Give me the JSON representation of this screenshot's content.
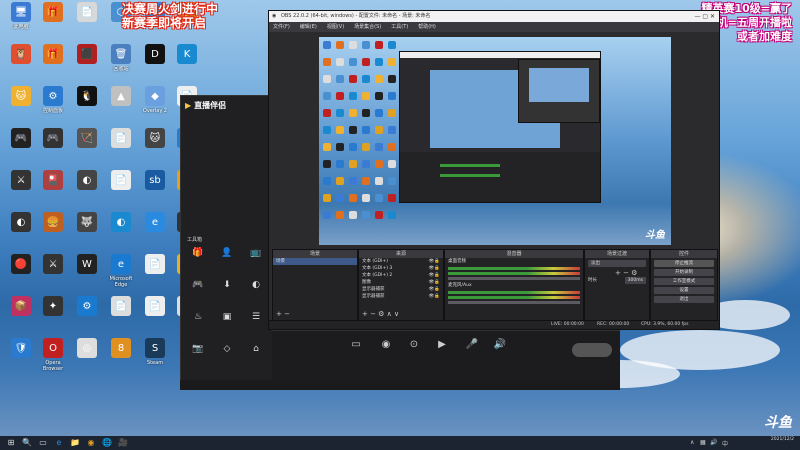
{
  "overlay": {
    "left_line1": "决赛周火剑进行中",
    "left_line2": "新赛季即将开启",
    "right_line1": "精英赛10级=赢了",
    "right_line2": "飞机=五周开播啦",
    "right_line3": "或者加难度"
  },
  "desktop_icons": [
    {
      "label": "此电脑",
      "glyph": "🖥",
      "color": "#3b7bd4"
    },
    {
      "label": "",
      "glyph": "🎁",
      "color": "#e07020"
    },
    {
      "label": "",
      "glyph": "📄",
      "color": "#d8d8d8"
    },
    {
      "label": "",
      "glyph": "⬡",
      "color": "#4a8fd0"
    },
    {
      "label": "网络",
      "glyph": "🌐",
      "color": "#3b7bd4"
    },
    {
      "label": "",
      "glyph": "🎁",
      "color": "#e07020"
    },
    {
      "label": "",
      "glyph": "🦉",
      "color": "#e05030"
    },
    {
      "label": "",
      "glyph": "🎁",
      "color": "#e07020"
    },
    {
      "label": "",
      "glyph": "⬛",
      "color": "#b02020"
    },
    {
      "label": "回收站",
      "glyph": "🗑",
      "color": "#4a7fc0"
    },
    {
      "label": "",
      "glyph": "D",
      "color": "#111"
    },
    {
      "label": "",
      "glyph": "K",
      "color": "#1a8ad0"
    },
    {
      "label": "",
      "glyph": "🐱",
      "color": "#f0b030"
    },
    {
      "label": "控制面板",
      "glyph": "⚙",
      "color": "#2a7ad0"
    },
    {
      "label": "",
      "glyph": "🐧",
      "color": "#111"
    },
    {
      "label": "",
      "glyph": "▲",
      "color": "#c0c0c0"
    },
    {
      "label": "Overlay 2",
      "glyph": "◆",
      "color": "#6aa0e0"
    },
    {
      "label": "",
      "glyph": "📄",
      "color": "#eee"
    },
    {
      "label": "",
      "glyph": "🎮",
      "color": "#222"
    },
    {
      "label": "",
      "glyph": "🎮",
      "color": "#333"
    },
    {
      "label": "",
      "glyph": "🏹",
      "color": "#555"
    },
    {
      "label": "",
      "glyph": "📄",
      "color": "#ddd"
    },
    {
      "label": "",
      "glyph": "🐱",
      "color": "#444"
    },
    {
      "label": "",
      "glyph": "🐦",
      "color": "#2a7ad0"
    },
    {
      "label": "",
      "glyph": "⚔",
      "color": "#333"
    },
    {
      "label": "",
      "glyph": "🎴",
      "color": "#b04040"
    },
    {
      "label": "",
      "glyph": "◐",
      "color": "#444"
    },
    {
      "label": "",
      "glyph": "📄",
      "color": "#eee"
    },
    {
      "label": "",
      "glyph": "sb",
      "color": "#1a5aa0"
    },
    {
      "label": "",
      "glyph": "◉",
      "color": "#e0a020"
    },
    {
      "label": "",
      "glyph": "◐",
      "color": "#333"
    },
    {
      "label": "",
      "glyph": "🍔",
      "color": "#c06020"
    },
    {
      "label": "",
      "glyph": "🐺",
      "color": "#444"
    },
    {
      "label": "",
      "glyph": "◐",
      "color": "#1a8ad0"
    },
    {
      "label": "",
      "glyph": "e",
      "color": "#2a8ae0"
    },
    {
      "label": "",
      "glyph": "◉",
      "color": "#333"
    },
    {
      "label": "",
      "glyph": "🔴",
      "color": "#222"
    },
    {
      "label": "",
      "glyph": "⚔",
      "color": "#333"
    },
    {
      "label": "",
      "glyph": "W",
      "color": "#222"
    },
    {
      "label": "Microsoft Edge",
      "glyph": "e",
      "color": "#1a7ad0"
    },
    {
      "label": "",
      "glyph": "📄",
      "color": "#eee"
    },
    {
      "label": "",
      "glyph": "📁",
      "color": "#e0b030"
    },
    {
      "label": "",
      "glyph": "📦",
      "color": "#c03060"
    },
    {
      "label": "",
      "glyph": "✦",
      "color": "#333"
    },
    {
      "label": "",
      "glyph": "⚙",
      "color": "#1a7ad0"
    },
    {
      "label": "",
      "glyph": "📄",
      "color": "#ddd"
    },
    {
      "label": "",
      "glyph": "📄",
      "color": "#eee"
    },
    {
      "label": "",
      "glyph": "📄",
      "color": "#ddd"
    },
    {
      "label": "",
      "glyph": "🛡",
      "color": "#2a7ad0"
    },
    {
      "label": "Opera Browser",
      "glyph": "O",
      "color": "#c02020"
    },
    {
      "label": "",
      "glyph": "◎",
      "color": "#ddd"
    },
    {
      "label": "",
      "glyph": "8",
      "color": "#e09020"
    },
    {
      "label": "Steam",
      "glyph": "S",
      "color": "#1a3a5a"
    }
  ],
  "helper": {
    "app_name": "直播伴侣",
    "badge": "",
    "tabs": [
      "",
      "",
      ""
    ],
    "empty_text": "",
    "tools_title": "工具箱",
    "tools": [
      {
        "icon": "🎁",
        "label": ""
      },
      {
        "icon": "👤",
        "label": ""
      },
      {
        "icon": "📺",
        "label": ""
      },
      {
        "icon": "🎮",
        "label": ""
      },
      {
        "icon": "⬇",
        "label": ""
      },
      {
        "icon": "◐",
        "label": ""
      },
      {
        "icon": "♨",
        "label": ""
      },
      {
        "icon": "▣",
        "label": ""
      },
      {
        "icon": "☰",
        "label": ""
      },
      {
        "icon": "📷",
        "label": ""
      },
      {
        "icon": "◇",
        "label": ""
      },
      {
        "icon": "⌂",
        "label": ""
      }
    ],
    "footer": ""
  },
  "livebar": {
    "controls": [
      {
        "icon": "▭",
        "label": ""
      },
      {
        "icon": "◉",
        "label": ""
      },
      {
        "icon": "⊙",
        "label": ""
      },
      {
        "icon": "▶",
        "label": ""
      },
      {
        "icon": "🎤",
        "label": ""
      },
      {
        "icon": "🔊",
        "label": ""
      }
    ],
    "start_label": "",
    "status": [
      "",
      "",
      "",
      "",
      "",
      ""
    ]
  },
  "obs": {
    "title": "OBS 22.0.2 (64-bit, windows) - 配置文件: 未命名 - 场景: 未命名",
    "menu": [
      "文件(F)",
      "编辑(E)",
      "视图(V)",
      "场景集合(S)",
      "工具(T)",
      "帮助(H)"
    ],
    "docks": {
      "scenes": {
        "title": "场景",
        "items": [
          "场景"
        ]
      },
      "sources": {
        "title": "来源",
        "items": [
          "文本 (GDI+)",
          "文本 (GDI+) 3",
          "文本 (GDI+) 2",
          "图像",
          "显示器捕获",
          "显示器捕获"
        ]
      },
      "mixer": {
        "title": "混音器",
        "channels": [
          "桌面音频",
          "麦克风/Aux"
        ]
      },
      "transitions": {
        "title": "场景过渡",
        "type": "淡出",
        "duration_label": "时长",
        "duration": "300ms"
      },
      "controls": {
        "title": "控件",
        "buttons": [
          "停止推流",
          "开始录制",
          "工作室模式",
          "设置",
          "退出"
        ]
      }
    },
    "status": {
      "live": "LIVE: 00:00:00",
      "rec": "REC: 00:00:00",
      "cpu": "CPU: 3.9%, 60.00 fps"
    }
  },
  "taskbar": {
    "apps": [
      "⊞",
      "🔍",
      "▭",
      "e",
      "📁",
      "◉",
      "🌐",
      "🎥"
    ],
    "time": "",
    "date": "2021/12/2"
  },
  "watermark": "斗鱼"
}
